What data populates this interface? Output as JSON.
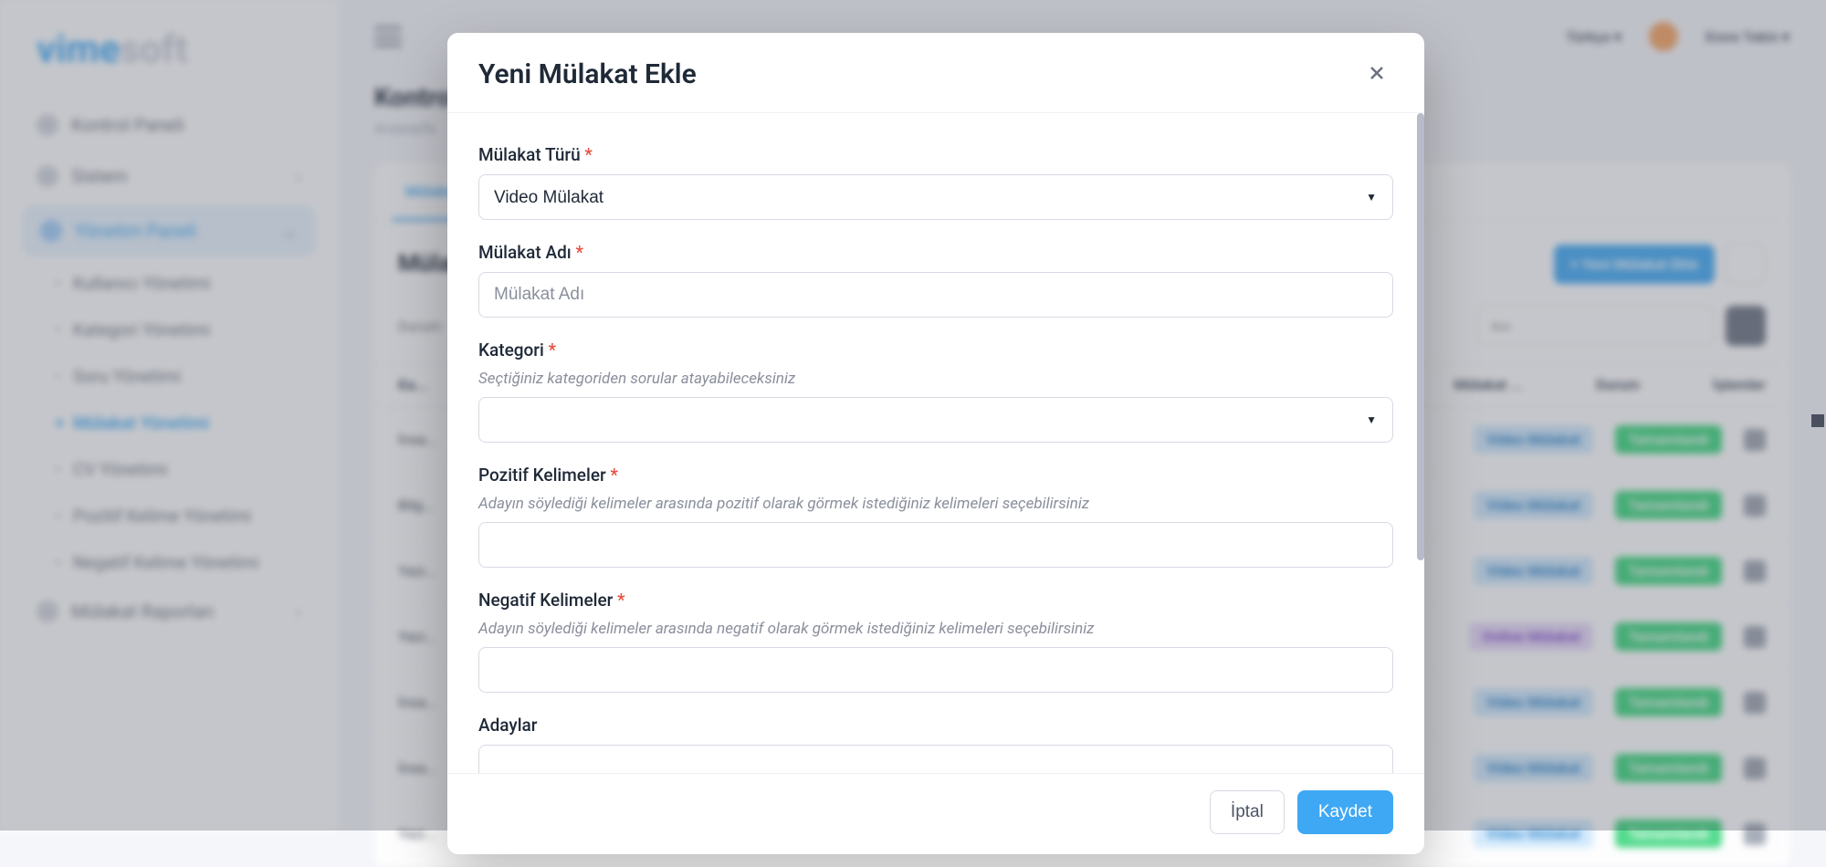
{
  "brand": {
    "part1": "vime",
    "part2": "soft"
  },
  "topbar": {
    "lang": "Türkçe",
    "user": "Emre Tekin"
  },
  "sidebar": {
    "items": [
      {
        "label": "Kontrol Paneli"
      },
      {
        "label": "Sistem"
      },
      {
        "label": "Yönetim Paneli"
      },
      {
        "label": "Mülakat Raporları"
      }
    ],
    "subitems": [
      {
        "label": "Kullanıcı Yönetimi"
      },
      {
        "label": "Kategori Yönetimi"
      },
      {
        "label": "Soru Yönetimi"
      },
      {
        "label": "Mülakat Yönetimi"
      },
      {
        "label": "CV Yönetimi"
      },
      {
        "label": "Pozitif Kelime Yönetimi"
      },
      {
        "label": "Negatif Kelime Yönetimi"
      }
    ]
  },
  "page": {
    "title": "Kontrol",
    "breadcrumb": "Anasayfa",
    "tab": "Mülakat",
    "card_title": "Mülak",
    "add_btn": "+ Yeni Mülakat Ekle",
    "search_placeholder": "Ara",
    "status_label": "Durum",
    "columns": {
      "cat": "Ka...",
      "type": "Mülakat ...",
      "status": "Durum",
      "actions": "İşlemler"
    }
  },
  "rows": [
    {
      "cat": "İnsa...",
      "type": "Video Mülakat",
      "type_style": "blue",
      "status": "Tamamlandı"
    },
    {
      "cat": "Bilg...",
      "type": "Video Mülakat",
      "type_style": "blue",
      "status": "Tamamlandı"
    },
    {
      "cat": "Yazı...",
      "type": "Video Mülakat",
      "type_style": "blue",
      "status": "Tamamlandı"
    },
    {
      "cat": "Yazı...",
      "type": "Online Mülakat",
      "type_style": "purple",
      "status": "Tamamlandı"
    },
    {
      "cat": "İnsa...",
      "type": "Video Mülakat",
      "type_style": "blue",
      "status": "Tamamlandı"
    },
    {
      "cat": "İnsa...",
      "type": "Video Mülakat",
      "type_style": "blue",
      "status": "Tamamlandı"
    },
    {
      "cat": "Yazı...",
      "type": "Video Mülakat",
      "type_style": "blue",
      "status": "Tamamlandı"
    }
  ],
  "modal": {
    "title": "Yeni Mülakat Ekle",
    "fields": {
      "type": {
        "label": "Mülakat Türü",
        "value": "Video Mülakat"
      },
      "name": {
        "label": "Mülakat Adı",
        "placeholder": "Mülakat Adı"
      },
      "category": {
        "label": "Kategori",
        "help": "Seçtiğiniz kategoriden sorular atayabileceksiniz"
      },
      "positive": {
        "label": "Pozitif Kelimeler",
        "help": "Adayın söylediği kelimeler arasında pozitif olarak görmek istediğiniz kelimeleri seçebilirsiniz"
      },
      "negative": {
        "label": "Negatif Kelimeler",
        "help": "Adayın söylediği kelimeler arasında negatif olarak görmek istediğiniz kelimeleri seçebilirsiniz"
      },
      "candidates": {
        "label": "Adaylar"
      }
    },
    "buttons": {
      "cancel": "İptal",
      "save": "Kaydet"
    }
  }
}
